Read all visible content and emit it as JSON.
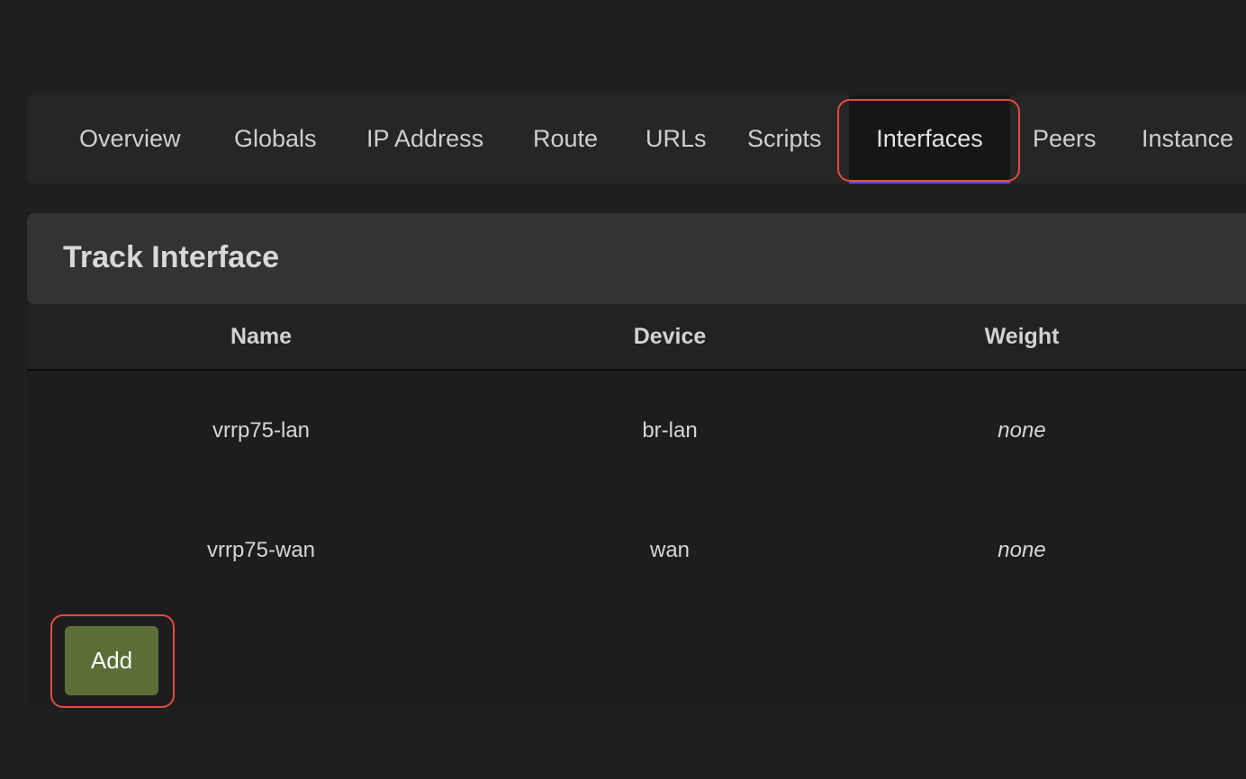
{
  "tabs": {
    "overview": "Overview",
    "globals": "Globals",
    "ip_address": "IP Address",
    "route": "Route",
    "urls": "URLs",
    "scripts": "Scripts",
    "interfaces": "Interfaces",
    "peers": "Peers",
    "instance": "Instance",
    "active": "Interfaces"
  },
  "section": {
    "title": "Track Interface"
  },
  "table": {
    "headers": {
      "name": "Name",
      "device": "Device",
      "weight": "Weight"
    },
    "rows": [
      {
        "name": "vrrp75-lan",
        "device": "br-lan",
        "weight": "none"
      },
      {
        "name": "vrrp75-wan",
        "device": "wan",
        "weight": "none"
      }
    ]
  },
  "actions": {
    "add_label": "Add"
  },
  "colors": {
    "accent_underline": "#5a55c9",
    "highlight_ring": "#e8493d",
    "add_button": "#5a6e36"
  }
}
